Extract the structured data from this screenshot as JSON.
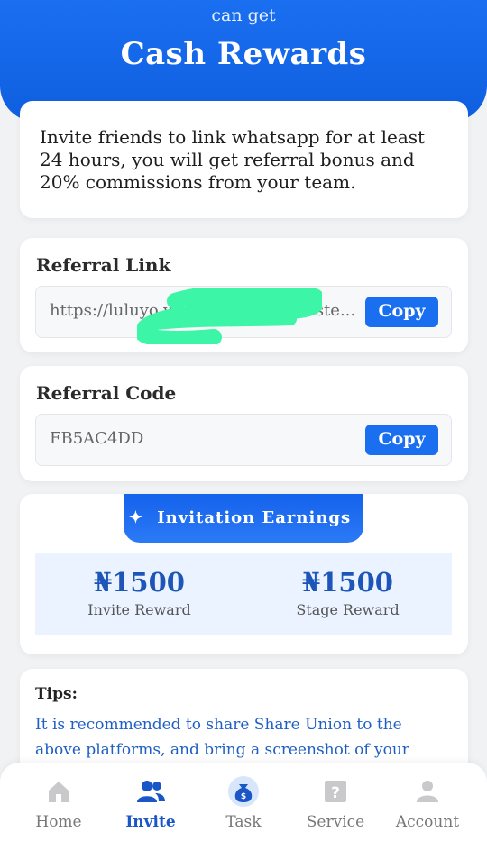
{
  "hero": {
    "subtitle": "can get",
    "title": "Cash Rewards"
  },
  "intro": {
    "text": "Invite friends to link whatsapp for at least 24 hours, you will get referral bonus and 20% commissions from your team."
  },
  "referral_link": {
    "title": "Referral Link",
    "value_start": "https://luluyo.vi",
    "value_end": "iste...",
    "copy_label": "Copy"
  },
  "referral_code": {
    "title": "Referral Code",
    "value": "FB5AC4DD",
    "copy_label": "Copy"
  },
  "earnings": {
    "title": "Invitation Earnings",
    "sparkle": "✦",
    "items": [
      {
        "value": "₦1500",
        "label": "Invite Reward"
      },
      {
        "value": "₦1500",
        "label": "Stage Reward"
      }
    ]
  },
  "tips": {
    "title": "Tips:",
    "text": "It is recommended to share Share Union to the above platforms, and bring a screenshot of your income,the"
  },
  "nav": {
    "items": [
      {
        "label": "Home",
        "icon": "home-icon"
      },
      {
        "label": "Invite",
        "icon": "users-icon",
        "active": true
      },
      {
        "label": "Task",
        "icon": "money-bag-icon"
      },
      {
        "label": "Service",
        "icon": "help-icon"
      },
      {
        "label": "Account",
        "icon": "user-icon"
      }
    ]
  },
  "colors": {
    "primary": "#1a6ff0",
    "earnings_value": "#1d55b8",
    "tips_text": "#1f5fc4",
    "redaction": "#3df5a6"
  }
}
